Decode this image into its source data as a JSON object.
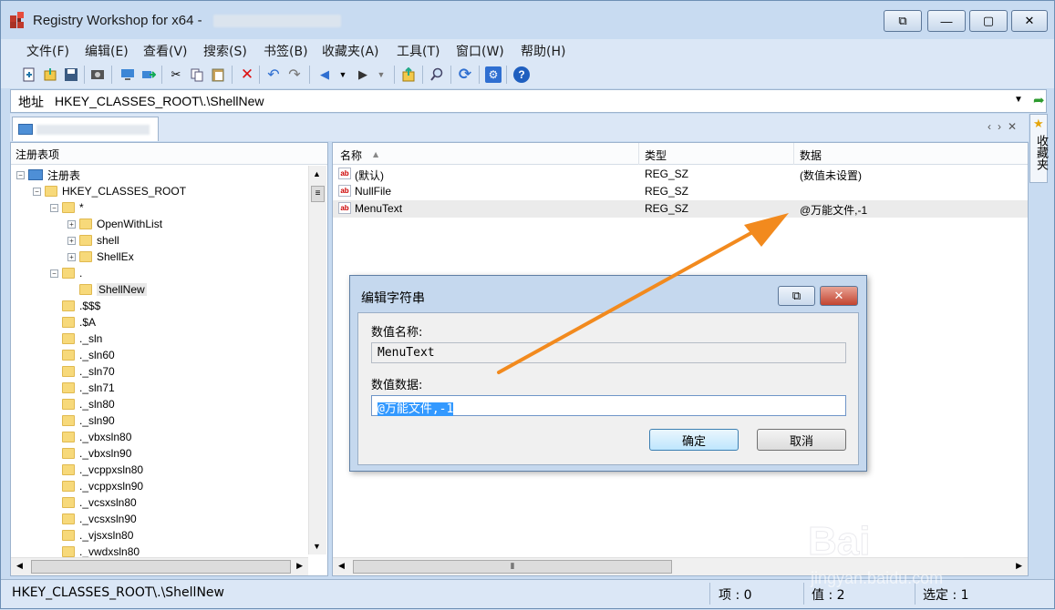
{
  "window": {
    "title": "Registry Workshop for x64 - "
  },
  "caption_buttons": [
    "⧉",
    "—",
    "▢",
    "✕"
  ],
  "menu": [
    "文件(F)",
    "编辑(E)",
    "查看(V)",
    "搜索(S)",
    "书签(B)",
    "收藏夹(A)",
    "工具(T)",
    "窗口(W)",
    "帮助(H)"
  ],
  "address": {
    "label": "地址",
    "value": "HKEY_CLASSES_ROOT\\.\\ShellNew"
  },
  "favorites_label": "收藏夹",
  "tree": {
    "header": "注册表项",
    "nodes": [
      {
        "label": "注册表",
        "depth": 0
      },
      {
        "label": "HKEY_CLASSES_ROOT",
        "depth": 1
      },
      {
        "label": "*",
        "depth": 2
      },
      {
        "label": "OpenWithList",
        "depth": 3
      },
      {
        "label": "shell",
        "depth": 3
      },
      {
        "label": "ShellEx",
        "depth": 3
      },
      {
        "label": ".",
        "depth": 2
      },
      {
        "label": "ShellNew",
        "depth": 3
      },
      {
        "label": ".$$$",
        "depth": 2
      },
      {
        "label": ".$A",
        "depth": 2
      },
      {
        "label": "._sln",
        "depth": 2
      },
      {
        "label": "._sln60",
        "depth": 2
      },
      {
        "label": "._sln70",
        "depth": 2
      },
      {
        "label": "._sln71",
        "depth": 2
      },
      {
        "label": "._sln80",
        "depth": 2
      },
      {
        "label": "._sln90",
        "depth": 2
      },
      {
        "label": "._vbxsln80",
        "depth": 2
      },
      {
        "label": "._vbxsln90",
        "depth": 2
      },
      {
        "label": "._vcppxsln80",
        "depth": 2
      },
      {
        "label": "._vcppxsln90",
        "depth": 2
      },
      {
        "label": "._vcsxsln80",
        "depth": 2
      },
      {
        "label": "._vcsxsln90",
        "depth": 2
      },
      {
        "label": "._vjsxsln80",
        "depth": 2
      },
      {
        "label": "._vwdxsln80",
        "depth": 2
      }
    ]
  },
  "list": {
    "columns": [
      "名称",
      "类型",
      "数据"
    ],
    "rows": [
      {
        "name": "(默认)",
        "type": "REG_SZ",
        "data": "(数值未设置)"
      },
      {
        "name": "NullFile",
        "type": "REG_SZ",
        "data": ""
      },
      {
        "name": "MenuText",
        "type": "REG_SZ",
        "data": "@万能文件,-1"
      }
    ]
  },
  "dialog": {
    "title": "编辑字符串",
    "name_label": "数值名称:",
    "name_value": "MenuText",
    "data_label": "数值数据:",
    "data_value": "@万能文件,-1",
    "ok": "确定",
    "cancel": "取消"
  },
  "status": {
    "path": "HKEY_CLASSES_ROOT\\.\\ShellNew",
    "items": "项 : 0",
    "values": "值 : 2",
    "selected": "选定 : 1"
  },
  "watermark": {
    "line1": "Baidu经验",
    "line2": "jingyan.baidu.com"
  },
  "colors": {
    "accent": "#f28a1e",
    "selection": "#3399ff"
  }
}
